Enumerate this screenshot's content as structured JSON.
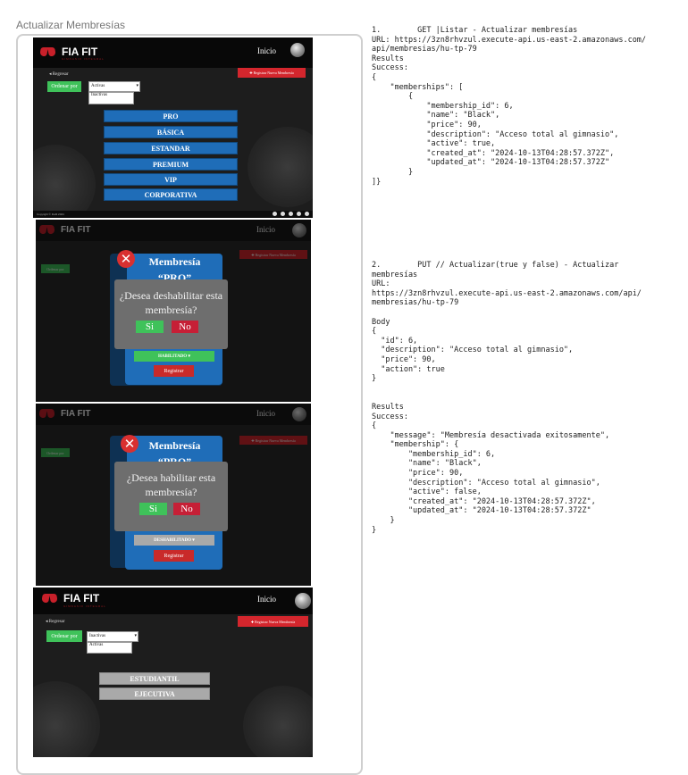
{
  "page_title": "Actualizar Membresías",
  "app": {
    "brand": "FIA FIT",
    "brand_sub": "GIMNASIO INTEGRAL",
    "nav_home": "Inicio",
    "back": "Regresar",
    "new_button": "Registrar Nueva Membresía",
    "order_by": "Ordenar por",
    "footer_copy": "Copyright © Fiafit 2024"
  },
  "screen1": {
    "select_value": "Activas",
    "options": [
      "Activas",
      "Inactivas"
    ],
    "plans": [
      "PRO",
      "BÁSICA",
      "ESTANDAR",
      "PREMIUM",
      "VIP",
      "CORPORATIVA"
    ]
  },
  "screen2": {
    "modal_title_line1": "Membresía",
    "modal_title_line2": "“PRO”",
    "question_line1": "¿Desea deshabilitar esta",
    "question_line2": "membresía?",
    "yes": "Si",
    "no": "No",
    "state_button": "HABILITADO",
    "register": "Registrar"
  },
  "screen3": {
    "modal_title_line1": "Membresía",
    "modal_title_line2": "“PRO”",
    "question_line1": "¿Desea habilitar esta",
    "question_line2": "membresía?",
    "yes": "Si",
    "no": "No",
    "state_button": "DESHABILITADO",
    "register": "Registrar"
  },
  "screen4": {
    "select_value": "Inactivas",
    "options": [
      "Inactivas",
      "Activas"
    ],
    "plans": [
      "ESTUDIANTIL",
      "EJECUTIVA"
    ]
  },
  "api_doc": {
    "block1": "1.        GET |Listar - Actualizar membresías\nURL: https://3zn8rhvzul.execute-api.us-east-2.amazonaws.com/\napi/membresias/hu-tp-79\nResults\nSuccess:\n{\n    \"memberships\": [\n        {\n            \"membership_id\": 6,\n            \"name\": \"Black\",\n            \"price\": 90,\n            \"description\": \"Acceso total al gimnasio\",\n            \"active\": true,\n            \"created_at\": \"2024-10-13T04:28:57.372Z\",\n            \"updated_at\": \"2024-10-13T04:28:57.372Z\"\n        }\n]}",
    "block2": "2.        PUT // Actualizar(true y false) - Actualizar\nmembresías\nURL:\nhttps://3zn8rhvzul.execute-api.us-east-2.amazonaws.com/api/\nmembresias/hu-tp-79\n\nBody\n{\n  \"id\": 6,\n  \"description\": \"Acceso total al gimnasio\",\n  \"price\": 90,\n  \"action\": true\n}\n\n\nResults\nSuccess:\n{\n    \"message\": \"Membresía desactivada exitosamente\",\n    \"membership\": {\n        \"membership_id\": 6,\n        \"name\": \"Black\",\n        \"price\": 90,\n        \"description\": \"Acceso total al gimnasio\",\n        \"active\": false,\n        \"created_at\": \"2024-10-13T04:28:57.372Z\",\n        \"updated_at\": \"2024-10-13T04:28:57.372Z\"\n    }\n}"
  }
}
